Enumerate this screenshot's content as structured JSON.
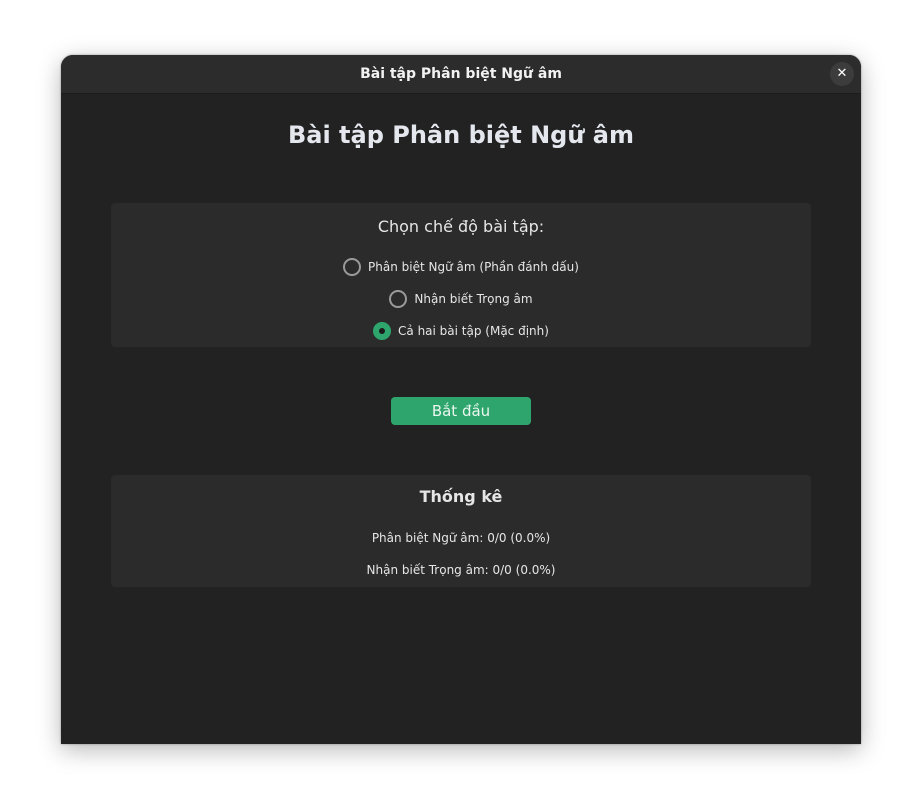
{
  "window": {
    "title": "Bài tập Phân biệt Ngữ âm",
    "close_glyph": "✕"
  },
  "main": {
    "heading": "Bài tập Phân biệt Ngữ âm"
  },
  "mode": {
    "label": "Chọn chế độ bài tập:",
    "options": [
      {
        "label": "Phân biệt Ngữ âm (Phần đánh dấu)",
        "checked": false
      },
      {
        "label": "Nhận biết Trọng âm",
        "checked": false
      },
      {
        "label": "Cả hai bài tập (Mặc định)",
        "checked": true
      }
    ]
  },
  "actions": {
    "start_label": "Bắt đầu"
  },
  "stats": {
    "title": "Thống kê",
    "lines": [
      "Phân biệt Ngữ âm: 0/0 (0.0%)",
      "Nhận biết Trọng âm: 0/0 (0.0%)"
    ]
  },
  "colors": {
    "accent": "#2ea56d",
    "background": "#222222",
    "panel": "#2b2b2b"
  }
}
